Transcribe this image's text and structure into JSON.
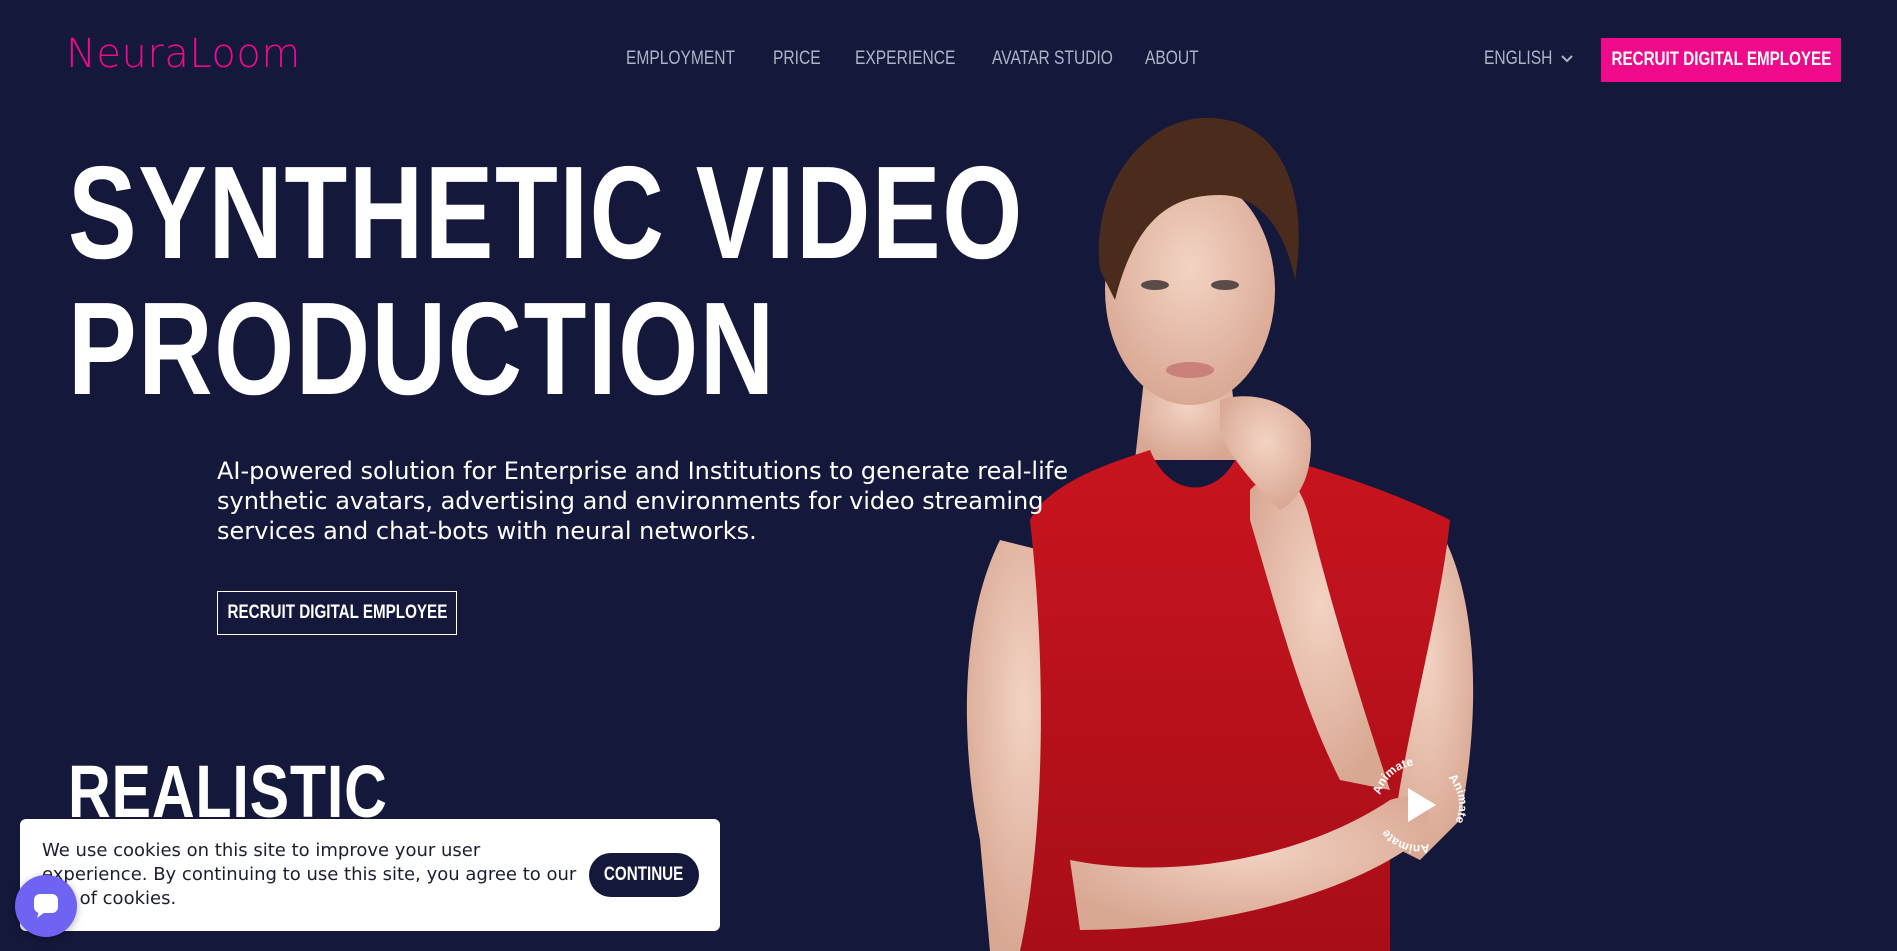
{
  "brand": {
    "logo_text": "NeuraLoom",
    "accent": "#ee0a8a",
    "background": "#14183a"
  },
  "nav": {
    "items": [
      "EMPLOYMENT",
      "PRICE",
      "EXPERIENCE",
      "AVATAR STUDIO",
      "ABOUT"
    ]
  },
  "language": {
    "selected": "ENGLISH",
    "icon": "chevron-down-icon"
  },
  "header": {
    "cta_label": "RECRUIT DIGITAL EMPLOYEE"
  },
  "hero": {
    "title_line1": "SYNTHETIC VIDEO",
    "title_line2": "PRODUCTION",
    "description": "AI-powered solution for Enterprise and Institutions to generate real-life synthetic avatars, advertising and environments for video streaming services and chat-bots with neural networks.",
    "cta_label": "RECRUIT DIGITAL EMPLOYEE"
  },
  "section": {
    "title": "REALISTIC"
  },
  "animate_badge": {
    "label": "Animate",
    "icon": "play-icon"
  },
  "cookie": {
    "text": "We use cookies on this site to improve your user experience. By continuing to use this site, you agree to our use of cookies.",
    "button_label": "CONTINUE"
  },
  "chat": {
    "icon": "chat-icon",
    "color": "#6e63f3"
  }
}
